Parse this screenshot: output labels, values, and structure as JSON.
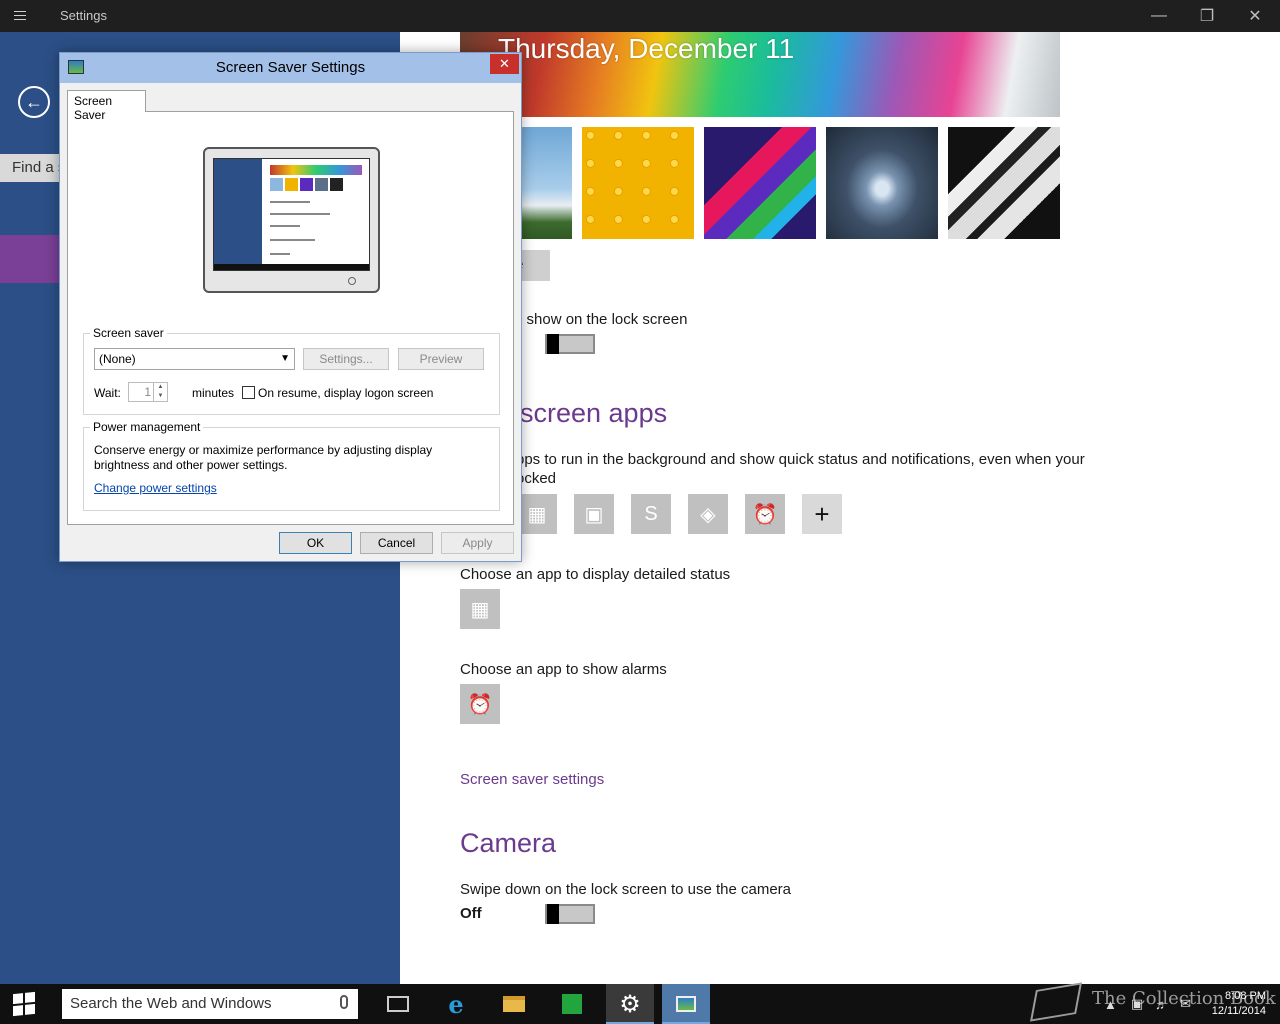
{
  "window": {
    "title": "Settings",
    "controls": {
      "minimize": "—",
      "restore": "❐",
      "close": "✕"
    }
  },
  "nav": {
    "search_placeholder": "Find a s"
  },
  "lockscreen": {
    "date": "Thursday, December 11",
    "browse_label": "e",
    "quick_status_text": "e show on the lock screen",
    "apps_heading": "screen apps",
    "apps_desc_line1": "pps to run in the background and show quick status and notifications, even when your",
    "apps_desc_line2": "ocked",
    "detailed_status_label": "Choose an app to display detailed status",
    "alarms_label": "Choose an app to show alarms",
    "screen_saver_link": "Screen saver settings",
    "camera_heading": "Camera",
    "camera_text": "Swipe down on the lock screen to use the camera",
    "camera_state": "Off",
    "quick_apps": [
      {
        "name": "calendar-icon",
        "glyph": "▦"
      },
      {
        "name": "radio-icon",
        "glyph": "▣"
      },
      {
        "name": "skype-icon",
        "glyph": "S"
      },
      {
        "name": "games-icon",
        "glyph": "◈"
      },
      {
        "name": "alarm-clock-icon",
        "glyph": "⏰"
      },
      {
        "name": "add-icon",
        "glyph": "+"
      }
    ]
  },
  "dialog": {
    "title": "Screen Saver Settings",
    "close": "✕",
    "tab": "Screen Saver",
    "screen_saver_group": "Screen saver",
    "selected_saver": "(None)",
    "settings_btn": "Settings...",
    "preview_btn": "Preview",
    "wait_label": "Wait:",
    "wait_value": "1",
    "minutes_label": "minutes",
    "resume_label": "On resume, display logon screen",
    "power_group": "Power management",
    "power_text_line1": "Conserve energy or maximize performance by adjusting display",
    "power_text_line2": "brightness and other power settings.",
    "power_link": "Change power settings",
    "ok_btn": "OK",
    "cancel_btn": "Cancel",
    "apply_btn": "Apply"
  },
  "taskbar": {
    "search_placeholder": "Search the Web and Windows",
    "watermark": "The Collection Book",
    "time": "8:08 PM",
    "date": "12/11/2014"
  },
  "colors": {
    "accent_purple": "#6b3a8e",
    "nav_blue": "#2b4f86",
    "taskbar": "#101010"
  }
}
